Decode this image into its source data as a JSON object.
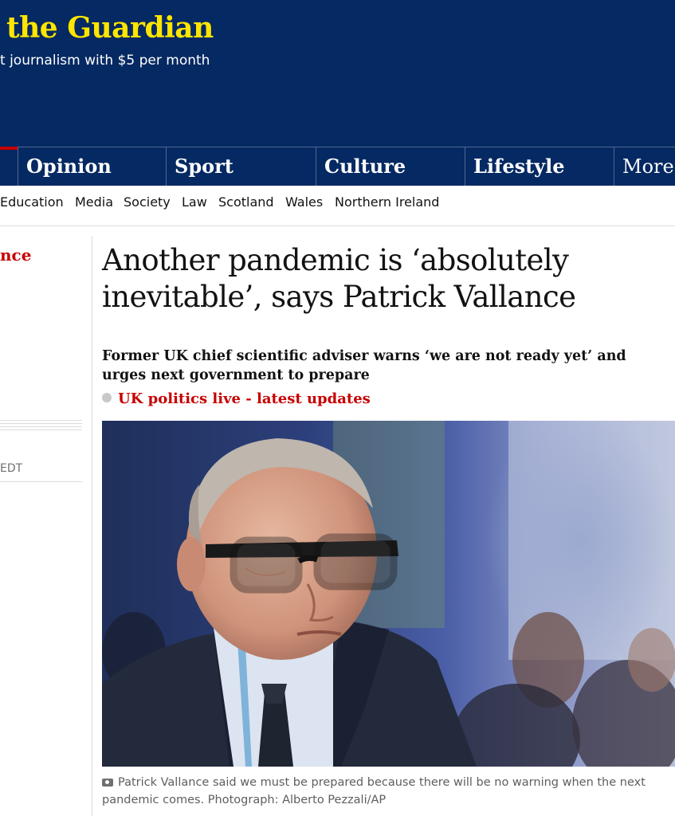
{
  "masthead": {
    "brand": "the Guardian",
    "support_text": "t journalism with $5 per month",
    "brand_color": "#ffe500",
    "background": "#052962"
  },
  "pillars": [
    {
      "label": "Opinion"
    },
    {
      "label": "Sport"
    },
    {
      "label": "Culture"
    },
    {
      "label": "Lifestyle"
    },
    {
      "label": "More"
    }
  ],
  "subnav": [
    "Education",
    "Media",
    "Society",
    "Law",
    "Scotland",
    "Wales",
    "Northern Ireland"
  ],
  "left_column": {
    "kicker": "nce",
    "time_fragment": "EDT"
  },
  "article": {
    "headline": "Another pandemic is ‘absolutely inevitable’, says Patrick Vallance",
    "standfirst": "Former UK chief scientific adviser warns ‘we are not ready yet’ and urges next government to prepare",
    "live_link": "UK politics live - latest updates",
    "accent_color": "#c70000",
    "image_icon": "photo-of-man-in-glasses",
    "caption": "Patrick Vallance said we must be prepared because there will be no warning when the next pandemic comes. Photograph: Alberto Pezzali/AP",
    "caption_icon": "camera-icon"
  }
}
